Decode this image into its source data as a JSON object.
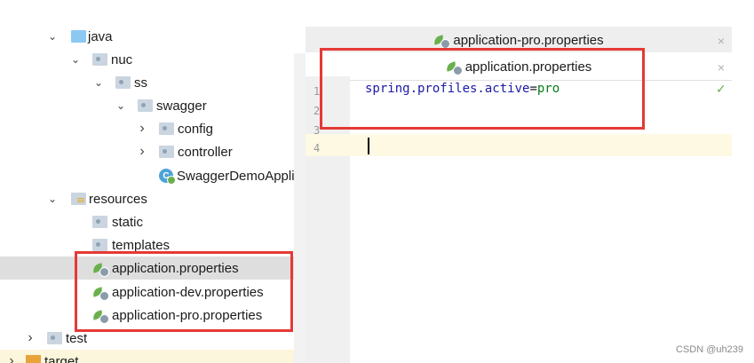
{
  "tree": {
    "items": [
      {
        "label": "java",
        "arrow": "⌄"
      },
      {
        "label": "nuc",
        "arrow": "⌄"
      },
      {
        "label": "ss",
        "arrow": "⌄"
      },
      {
        "label": "swagger",
        "arrow": "⌄"
      },
      {
        "label": "config",
        "arrow": "›"
      },
      {
        "label": "controller",
        "arrow": "›"
      },
      {
        "label": "SwaggerDemoAppli"
      },
      {
        "label": "resources",
        "arrow": "⌄"
      },
      {
        "label": "static"
      },
      {
        "label": "templates"
      },
      {
        "label": "application.properties"
      },
      {
        "label": "application-dev.properties"
      },
      {
        "label": "application-pro.properties"
      },
      {
        "label": "test",
        "arrow": "›"
      },
      {
        "label": "target",
        "arrow": "›"
      }
    ]
  },
  "editor": {
    "tabs": [
      {
        "label": "application-pro.properties",
        "close": "×"
      },
      {
        "label": "application.properties",
        "close": "×"
      }
    ],
    "line_numbers": [
      "1",
      "2",
      "3",
      "4"
    ],
    "code": {
      "key": "spring.profiles.active",
      "eq": "=",
      "value": "pro"
    },
    "check": "✓"
  },
  "class_badge": "C",
  "watermark": "CSDN @uh239",
  "colors": {
    "highlight_box": "#e53935",
    "selected_row": "#dedede",
    "current_line": "#fdf9e2"
  }
}
